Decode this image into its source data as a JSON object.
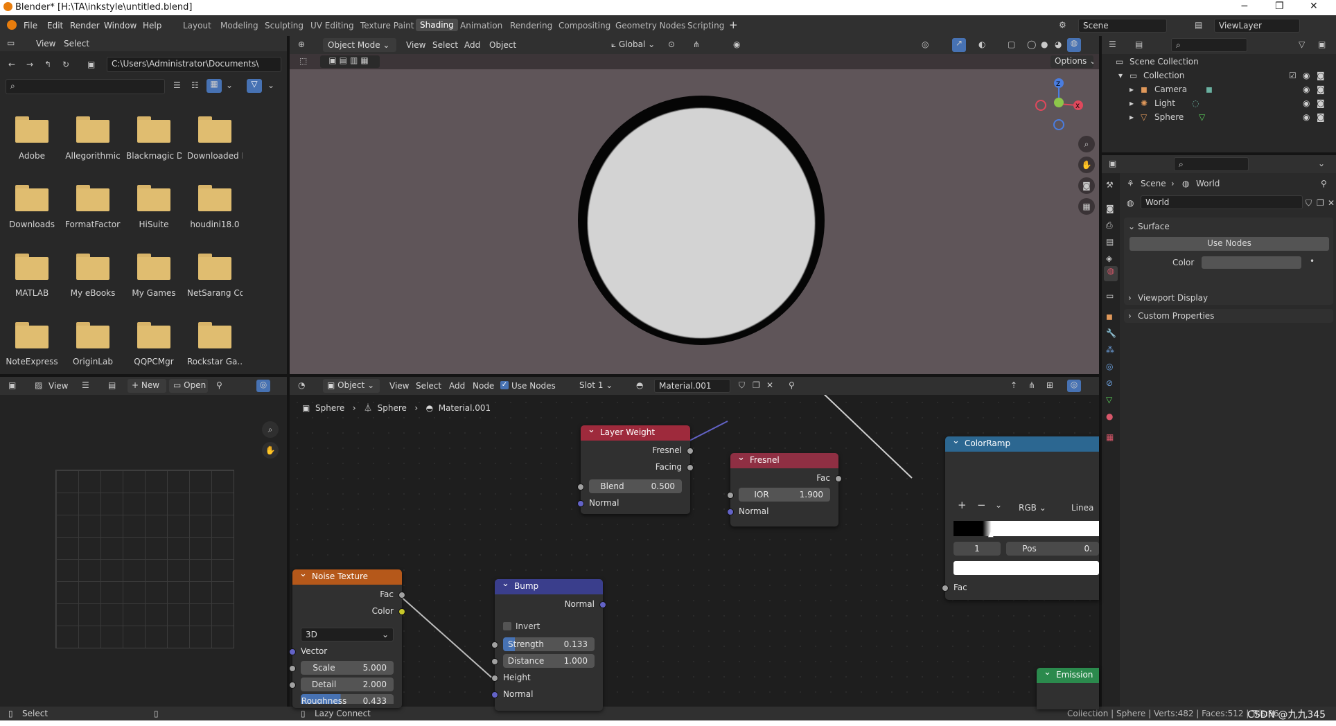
{
  "window": {
    "title": "Blender* [H:\\TA\\inkstyle\\untitled.blend]",
    "min": "−",
    "max": "❐",
    "close": "✕"
  },
  "menu": [
    "File",
    "Edit",
    "Render",
    "Window",
    "Help"
  ],
  "workspaces": [
    "Layout",
    "Modeling",
    "Sculpting",
    "UV Editing",
    "Texture Paint",
    "Shading",
    "Animation",
    "Rendering",
    "Compositing",
    "Geometry Nodes",
    "Scripting"
  ],
  "workspace_active": "Shading",
  "scene_name": "Scene",
  "view_layer": "ViewLayer",
  "file_browser": {
    "menu": [
      "View",
      "Select"
    ],
    "path": "C:\\Users\\Administrator\\Documents\\",
    "folders": [
      "Adobe",
      "Allegorithmic",
      "Blackmagic D",
      "Downloaded I...",
      "Downloads",
      "FormatFactory",
      "HiSuite",
      "houdini18.0",
      "MATLAB",
      "My eBooks",
      "My Games",
      "NetSarang Co...",
      "NoteExpress",
      "OriginLab",
      "QQPCMgr",
      "Rockstar Ga..."
    ]
  },
  "viewport_header": {
    "mode": "Object Mode",
    "menu": [
      "View",
      "Select",
      "Add",
      "Object"
    ],
    "orientation": "Global",
    "options": "Options"
  },
  "image_editor": {
    "view": "View",
    "new": "New",
    "open": "Open"
  },
  "node_header": {
    "object": "Object",
    "menu": [
      "View",
      "Select",
      "Add",
      "Node"
    ],
    "use_nodes": "Use Nodes",
    "slot": "Slot 1",
    "material": "Material.001"
  },
  "breadcrumb": [
    "Sphere",
    "Sphere",
    "Material.001"
  ],
  "nodes": {
    "layer_weight": {
      "title": "Layer Weight",
      "out1": "Fresnel",
      "out2": "Facing",
      "blend_label": "Blend",
      "blend_value": "0.500",
      "normal": "Normal"
    },
    "fresnel": {
      "title": "Fresnel",
      "out": "Fac",
      "ior_label": "IOR",
      "ior_value": "1.900",
      "normal": "Normal"
    },
    "colorramp": {
      "title": "ColorRamp",
      "mode": "RGB",
      "interp": "Linea",
      "index": "1",
      "pos": "Pos",
      "pos_value": "0.",
      "fac": "Fac"
    },
    "noise": {
      "title": "Noise Texture",
      "out1": "Fac",
      "out2": "Color",
      "dim": "3D",
      "vector": "Vector",
      "scale_label": "Scale",
      "scale_value": "5.000",
      "detail_label": "Detail",
      "detail_value": "2.000",
      "rough_label": "Roughness",
      "rough_value": "0.433"
    },
    "bump": {
      "title": "Bump",
      "out": "Normal",
      "invert": "Invert",
      "strength_label": "Strength",
      "strength_value": "0.133",
      "distance_label": "Distance",
      "distance_value": "1.000",
      "height": "Height",
      "normal": "Normal"
    },
    "emission": {
      "title": "Emission"
    }
  },
  "outliner": {
    "root": "Scene Collection",
    "collection": "Collection",
    "items": [
      "Camera",
      "Light",
      "Sphere"
    ]
  },
  "properties": {
    "crumb1": "Scene",
    "crumb2": "World",
    "world_name": "World",
    "surface": "Surface",
    "use_nodes": "Use Nodes",
    "color": "Color",
    "viewport_display": "Viewport Display",
    "custom_properties": "Custom Properties"
  },
  "status": {
    "select": "Select",
    "lazy": "Lazy Connect",
    "stats": "Collection | Sphere | Verts:482 | Faces:512 | Tris:96",
    "watermark": "CSDN @九九345"
  },
  "colors": {
    "accent": "#4772b3",
    "geometry_header": "#9e2a3c",
    "input_header": "#8f2f43",
    "texture_header": "#b5581a",
    "vector_header": "#3a3e8c",
    "converter_header": "#2c6791",
    "shader_header": "#2b8a4d"
  }
}
